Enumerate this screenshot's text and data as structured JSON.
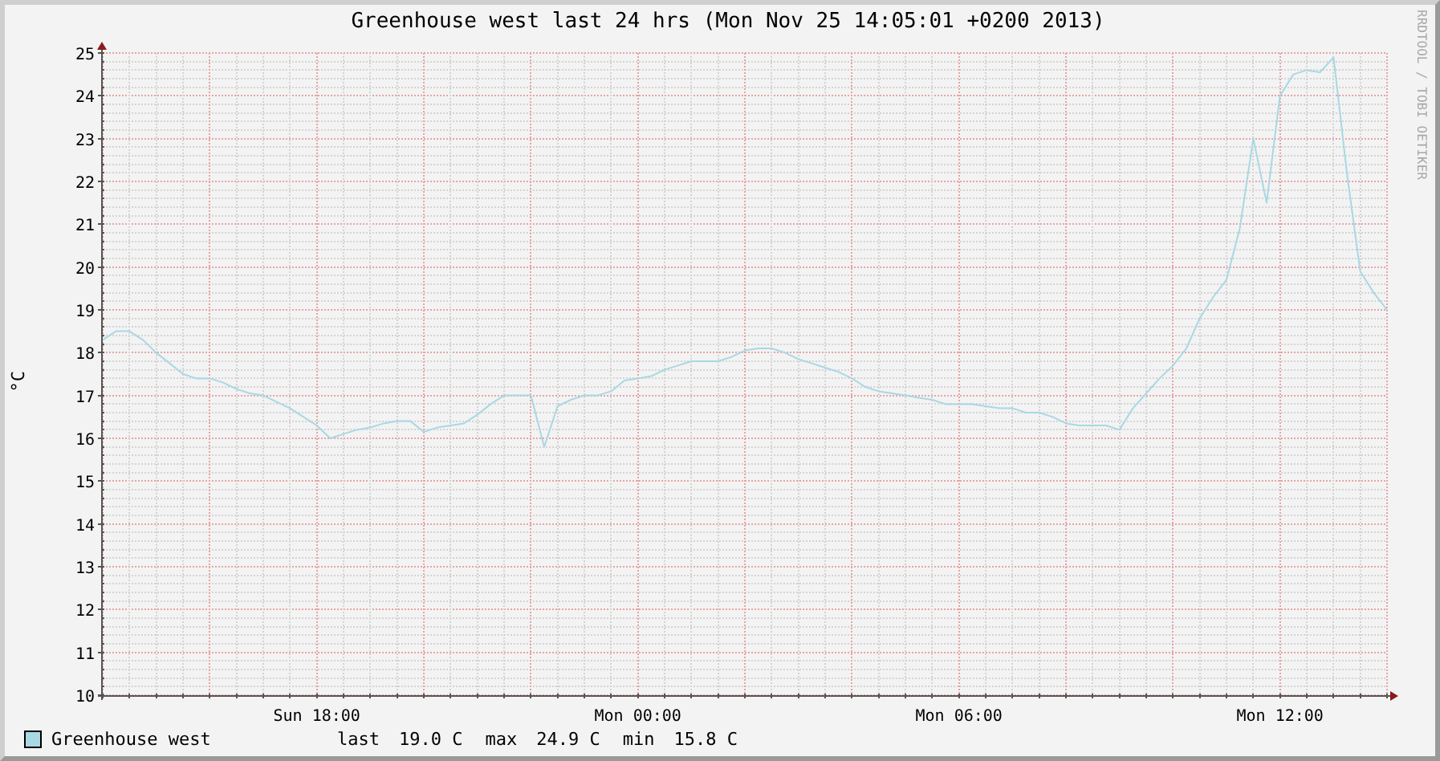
{
  "chart_data": {
    "type": "line",
    "title": "Greenhouse west last 24 hrs (Mon Nov 25 14:05:01 +0200 2013)",
    "ylabel": "°C",
    "categories": [
      null,
      null,
      null,
      null,
      null,
      null,
      null,
      null,
      null,
      null,
      null,
      null,
      null,
      null,
      null,
      null,
      "Sun 18:00",
      null,
      null,
      null,
      null,
      null,
      null,
      null,
      null,
      null,
      null,
      null,
      null,
      null,
      null,
      null,
      null,
      null,
      null,
      null,
      null,
      null,
      null,
      null,
      "Mon 00:00",
      null,
      null,
      null,
      null,
      null,
      null,
      null,
      null,
      null,
      null,
      null,
      null,
      null,
      null,
      null,
      null,
      null,
      null,
      null,
      null,
      null,
      null,
      null,
      "Mon 06:00",
      null,
      null,
      null,
      null,
      null,
      null,
      null,
      null,
      null,
      null,
      null,
      null,
      null,
      null,
      null,
      null,
      null,
      null,
      null,
      null,
      null,
      null,
      null,
      "Mon 12:00",
      null,
      null,
      null,
      null,
      null,
      null,
      null,
      null
    ],
    "series": [
      {
        "name": "Greenhouse west",
        "color": "#a8d8e4",
        "values": [
          18.3,
          18.5,
          18.5,
          18.3,
          18.0,
          17.75,
          17.5,
          17.4,
          17.4,
          17.3,
          17.15,
          17.05,
          17.0,
          16.85,
          16.7,
          16.5,
          16.3,
          16.0,
          16.1,
          16.2,
          16.25,
          16.35,
          16.4,
          16.4,
          16.15,
          16.25,
          16.3,
          16.35,
          16.55,
          16.8,
          17.0,
          17.0,
          17.0,
          15.8,
          16.75,
          16.9,
          17.0,
          17.0,
          17.1,
          17.35,
          17.4,
          17.45,
          17.6,
          17.7,
          17.8,
          17.8,
          17.8,
          17.9,
          18.05,
          18.1,
          18.1,
          18.0,
          17.85,
          17.75,
          17.65,
          17.55,
          17.4,
          17.2,
          17.1,
          17.05,
          17.0,
          16.95,
          16.9,
          16.8,
          16.8,
          16.8,
          16.75,
          16.7,
          16.7,
          16.6,
          16.6,
          16.5,
          16.35,
          16.3,
          16.3,
          16.3,
          16.2,
          16.7,
          17.05,
          17.4,
          17.7,
          18.1,
          18.8,
          19.3,
          19.7,
          20.9,
          23.0,
          21.5,
          24.0,
          24.5,
          24.6,
          24.55,
          24.9,
          22.2,
          19.9,
          19.4,
          19.0
        ]
      }
    ],
    "grid": true,
    "ylim": [
      10,
      25
    ],
    "yticks": [
      10,
      11,
      12,
      13,
      14,
      15,
      16,
      17,
      18,
      19,
      20,
      21,
      22,
      23,
      24,
      25
    ]
  },
  "legend": {
    "stats": [
      {
        "label": "last",
        "value": "19.0 C"
      },
      {
        "label": "max",
        "value": "24.9 C"
      },
      {
        "label": "min",
        "value": "15.8 C"
      }
    ]
  },
  "credit": "RRDTOOL / TOBI OETIKER"
}
